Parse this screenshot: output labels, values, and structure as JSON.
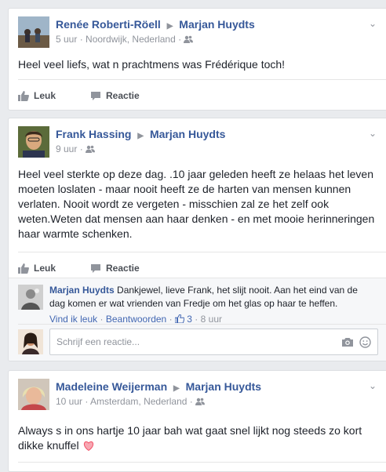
{
  "posts": [
    {
      "author": "Renée Roberti-Röell",
      "target": "Marjan Huydts",
      "time": "5 uur",
      "location": "Noordwijk, Nederland",
      "text": "Heel veel liefs, wat n prachtmens was Frédérique toch!",
      "like_label": "Leuk",
      "comment_label": "Reactie"
    },
    {
      "author": "Frank Hassing",
      "target": "Marjan Huydts",
      "time": "9 uur",
      "text_lines": [
        "Heel veel sterkte op deze dag. .10 jaar geleden heeft ze helaas het leven",
        "moeten loslaten - maar nooit heeft ze de harten van mensen kunnen",
        "verlaten. Nooit wordt ze vergeten - misschien zal ze het zelf ook",
        "weten.Weten dat mensen aan haar denken - en met mooie herinneringen",
        "haar warmte schenken."
      ],
      "like_label": "Leuk",
      "comment_label": "Reactie",
      "reply": {
        "author": "Marjan Huydts",
        "text_line1": "Dankjewel, lieve Frank, het slijt nooit. Aan het eind van de",
        "text_line2": "dag komen er wat vrienden van Fredje om het glas op haar te heffen.",
        "like_link": "Vind ik leuk",
        "reply_link": "Beantwoorden",
        "like_count": "3",
        "time": "8 uur"
      },
      "comment_placeholder": "Schrijf een reactie..."
    },
    {
      "author": "Madeleine Weijerman",
      "target": "Marjan Huydts",
      "time": "10 uur",
      "location": "Amsterdam, Nederland",
      "text_line1": "Always s in ons hartje 10 jaar bah wat gaat snel lijkt nog steeds zo kort",
      "text_line2": "dikke knuffel"
    }
  ],
  "colors": {
    "background": "#e9ebee",
    "link_blue": "#365899",
    "meta_grey": "#90949c",
    "heart": "#f25268"
  },
  "icons": [
    "triangle-right-icon",
    "friends-icon",
    "like-thumb-icon",
    "comment-bubble-icon",
    "camera-icon",
    "smiley-icon",
    "heart-icon",
    "chevron-down-icon"
  ]
}
